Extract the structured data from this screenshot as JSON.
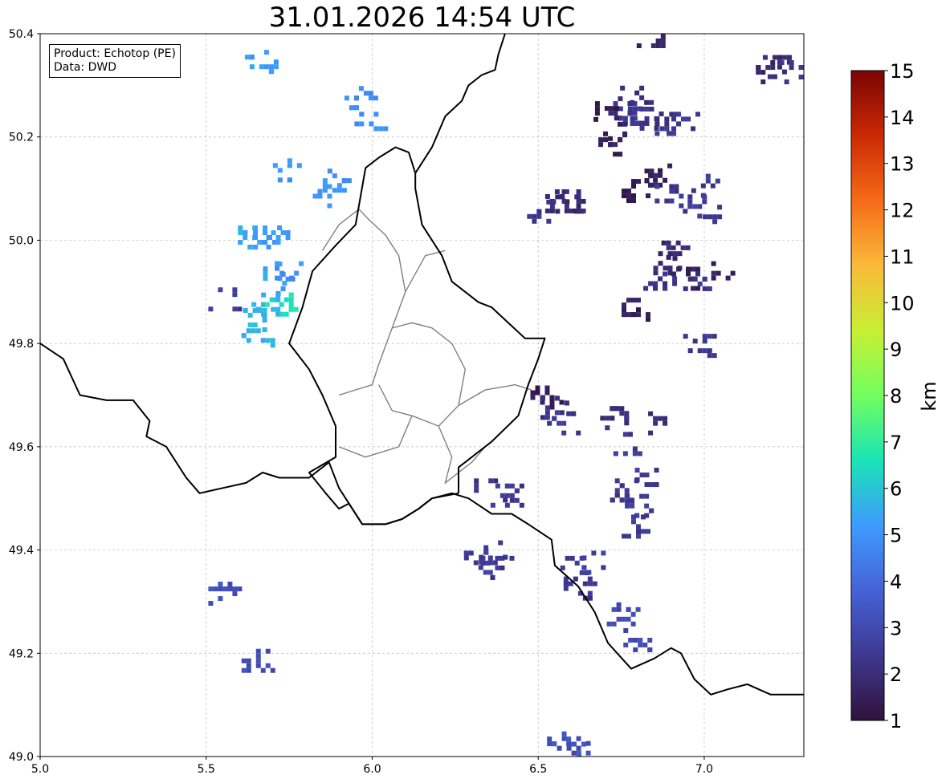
{
  "title": "31.01.2026 14:54 UTC",
  "info": {
    "product": "Product: Echotop (PE)",
    "source": "Data: DWD"
  },
  "map": {
    "lon_range": [
      5.0,
      7.3
    ],
    "lat_range": [
      49.0,
      50.4
    ],
    "x_ticks": [
      "5.0",
      "5.5",
      "6.0",
      "6.5",
      "7.0"
    ],
    "y_ticks": [
      "50.4",
      "50.2",
      "50.0",
      "49.8",
      "49.6",
      "49.4",
      "49.2",
      "49.0"
    ],
    "grid": true
  },
  "colorbar": {
    "label": "km",
    "min": 1,
    "max": 15,
    "ticks": [
      "15",
      "14",
      "13",
      "12",
      "11",
      "10",
      "9",
      "8",
      "7",
      "6",
      "5",
      "4",
      "3",
      "2",
      "1"
    ],
    "colormap": [
      "#30123b",
      "#3e3891",
      "#4662d7",
      "#3e9bfe",
      "#1ae4b6",
      "#72fe5e",
      "#c7ef34",
      "#faba39",
      "#f66b19",
      "#ca2a04",
      "#7a0403"
    ]
  },
  "echoes": [
    {
      "lon": 5.66,
      "lat": 50.35,
      "km": 5.2
    },
    {
      "lon": 5.96,
      "lat": 50.28,
      "km": 4.8
    },
    {
      "lon": 5.99,
      "lat": 50.23,
      "km": 5.0
    },
    {
      "lon": 5.73,
      "lat": 50.14,
      "km": 5.0
    },
    {
      "lon": 5.85,
      "lat": 50.09,
      "km": 5.1
    },
    {
      "lon": 5.88,
      "lat": 50.12,
      "km": 5.0
    },
    {
      "lon": 5.61,
      "lat": 50.01,
      "km": 5.6
    },
    {
      "lon": 5.67,
      "lat": 50.01,
      "km": 5.2
    },
    {
      "lon": 5.71,
      "lat": 50.01,
      "km": 5.2
    },
    {
      "lon": 5.7,
      "lat": 49.94,
      "km": 5.3
    },
    {
      "lon": 5.71,
      "lat": 49.92,
      "km": 5.0
    },
    {
      "lon": 5.68,
      "lat": 49.88,
      "km": 5.6
    },
    {
      "lon": 5.72,
      "lat": 49.88,
      "km": 6.5
    },
    {
      "lon": 5.64,
      "lat": 49.85,
      "km": 5.8
    },
    {
      "lon": 5.65,
      "lat": 49.82,
      "km": 5.6
    },
    {
      "lon": 5.75,
      "lat": 49.95,
      "km": 5.0
    },
    {
      "lon": 5.55,
      "lat": 49.89,
      "km": 2.5
    },
    {
      "lon": 5.55,
      "lat": 49.32,
      "km": 3.2
    },
    {
      "lon": 5.65,
      "lat": 49.19,
      "km": 3.0
    },
    {
      "lon": 6.32,
      "lat": 49.38,
      "km": 2.5
    },
    {
      "lon": 6.37,
      "lat": 49.37,
      "km": 2.4
    },
    {
      "lon": 6.35,
      "lat": 49.4,
      "km": 2.4
    },
    {
      "lon": 6.35,
      "lat": 49.52,
      "km": 2.2
    },
    {
      "lon": 6.4,
      "lat": 49.51,
      "km": 2.4
    },
    {
      "lon": 6.52,
      "lat": 49.7,
      "km": 1.4
    },
    {
      "lon": 6.55,
      "lat": 49.68,
      "km": 2.2
    },
    {
      "lon": 6.57,
      "lat": 49.65,
      "km": 2.4
    },
    {
      "lon": 6.61,
      "lat": 49.37,
      "km": 2.5
    },
    {
      "lon": 6.66,
      "lat": 49.38,
      "km": 2.5
    },
    {
      "lon": 6.62,
      "lat": 49.33,
      "km": 2.4
    },
    {
      "lon": 6.75,
      "lat": 49.28,
      "km": 3.0
    },
    {
      "lon": 6.8,
      "lat": 49.23,
      "km": 3.0
    },
    {
      "lon": 6.6,
      "lat": 49.03,
      "km": 3.2
    },
    {
      "lon": 6.63,
      "lat": 49.01,
      "km": 3.4
    },
    {
      "lon": 6.57,
      "lat": 49.02,
      "km": 3.2
    },
    {
      "lon": 6.76,
      "lat": 49.52,
      "km": 2.4
    },
    {
      "lon": 6.79,
      "lat": 49.49,
      "km": 2.5
    },
    {
      "lon": 6.78,
      "lat": 49.45,
      "km": 2.4
    },
    {
      "lon": 6.82,
      "lat": 49.55,
      "km": 2.4
    },
    {
      "lon": 6.77,
      "lat": 49.61,
      "km": 2.4
    },
    {
      "lon": 6.86,
      "lat": 49.65,
      "km": 2.0
    },
    {
      "lon": 6.73,
      "lat": 49.66,
      "km": 2.0
    },
    {
      "lon": 6.78,
      "lat": 49.87,
      "km": 1.5
    },
    {
      "lon": 6.98,
      "lat": 49.8,
      "km": 2.4
    },
    {
      "lon": 6.55,
      "lat": 50.08,
      "km": 2.0
    },
    {
      "lon": 6.51,
      "lat": 50.06,
      "km": 2.2
    },
    {
      "lon": 6.58,
      "lat": 50.07,
      "km": 1.8
    },
    {
      "lon": 6.77,
      "lat": 50.25,
      "km": 2.4
    },
    {
      "lon": 6.82,
      "lat": 50.24,
      "km": 2.3
    },
    {
      "lon": 6.88,
      "lat": 50.23,
      "km": 2.2
    },
    {
      "lon": 6.93,
      "lat": 50.23,
      "km": 2.4
    },
    {
      "lon": 6.74,
      "lat": 50.26,
      "km": 2.2
    },
    {
      "lon": 6.79,
      "lat": 50.29,
      "km": 2.0
    },
    {
      "lon": 6.82,
      "lat": 50.12,
      "km": 1.5
    },
    {
      "lon": 6.78,
      "lat": 50.1,
      "km": 1.4
    },
    {
      "lon": 6.86,
      "lat": 50.13,
      "km": 1.6
    },
    {
      "lon": 6.88,
      "lat": 50.09,
      "km": 2.3
    },
    {
      "lon": 6.95,
      "lat": 50.07,
      "km": 2.4
    },
    {
      "lon": 6.99,
      "lat": 50.11,
      "km": 2.4
    },
    {
      "lon": 7.01,
      "lat": 50.05,
      "km": 2.2
    },
    {
      "lon": 6.89,
      "lat": 49.96,
      "km": 1.8
    },
    {
      "lon": 6.86,
      "lat": 49.93,
      "km": 2.2
    },
    {
      "lon": 6.93,
      "lat": 49.93,
      "km": 1.6
    },
    {
      "lon": 6.98,
      "lat": 49.92,
      "km": 2.3
    },
    {
      "lon": 6.9,
      "lat": 49.99,
      "km": 1.9
    },
    {
      "lon": 7.05,
      "lat": 49.95,
      "km": 1.6
    },
    {
      "lon": 6.84,
      "lat": 50.4,
      "km": 1.7
    },
    {
      "lon": 7.22,
      "lat": 50.34,
      "km": 1.9
    },
    {
      "lon": 7.27,
      "lat": 50.33,
      "km": 2.2
    },
    {
      "lon": 7.17,
      "lat": 50.33,
      "km": 1.8
    },
    {
      "lon": 6.7,
      "lat": 50.26,
      "km": 1.5
    },
    {
      "lon": 6.71,
      "lat": 50.22,
      "km": 1.6
    },
    {
      "lon": 6.71,
      "lat": 50.19,
      "km": 1.6
    },
    {
      "lon": 6.6,
      "lat": 50.08,
      "km": 1.8
    }
  ],
  "borders": {
    "country": [
      [
        [
          5.0,
          49.8
        ],
        [
          5.07,
          49.77
        ],
        [
          5.12,
          49.7
        ],
        [
          5.2,
          49.69
        ],
        [
          5.28,
          49.69
        ],
        [
          5.33,
          49.65
        ],
        [
          5.32,
          49.62
        ],
        [
          5.38,
          49.6
        ],
        [
          5.44,
          49.54
        ],
        [
          5.48,
          49.51
        ],
        [
          5.55,
          49.52
        ],
        [
          5.62,
          49.53
        ],
        [
          5.67,
          49.55
        ],
        [
          5.72,
          49.54
        ],
        [
          5.81,
          49.54
        ],
        [
          5.87,
          49.57
        ],
        [
          5.9,
          49.52
        ],
        [
          5.93,
          49.49
        ]
      ],
      [
        [
          5.93,
          49.49
        ],
        [
          5.97,
          49.45
        ],
        [
          6.04,
          49.45
        ],
        [
          6.09,
          49.46
        ],
        [
          6.14,
          49.48
        ],
        [
          6.18,
          49.5
        ],
        [
          6.24,
          49.51
        ],
        [
          6.29,
          49.5
        ],
        [
          6.36,
          49.47
        ],
        [
          6.42,
          49.47
        ],
        [
          6.47,
          49.45
        ],
        [
          6.54,
          49.42
        ],
        [
          6.55,
          49.37
        ],
        [
          6.62,
          49.33
        ],
        [
          6.67,
          49.28
        ],
        [
          6.71,
          49.22
        ],
        [
          6.78,
          49.17
        ],
        [
          6.85,
          49.19
        ],
        [
          6.9,
          49.21
        ],
        [
          6.93,
          49.2
        ],
        [
          6.97,
          49.15
        ],
        [
          7.02,
          49.12
        ],
        [
          7.07,
          49.13
        ],
        [
          7.13,
          49.14
        ],
        [
          7.2,
          49.12
        ],
        [
          7.3,
          49.12
        ]
      ],
      [
        [
          6.26,
          49.51
        ],
        [
          6.26,
          49.56
        ],
        [
          6.36,
          49.61
        ],
        [
          6.44,
          49.66
        ],
        [
          6.47,
          49.72
        ],
        [
          6.5,
          49.77
        ],
        [
          6.52,
          49.81
        ],
        [
          6.46,
          49.81
        ],
        [
          6.36,
          49.87
        ],
        [
          6.32,
          49.88
        ],
        [
          6.24,
          49.92
        ],
        [
          6.21,
          49.97
        ],
        [
          6.15,
          50.03
        ],
        [
          6.13,
          50.1
        ],
        [
          6.13,
          50.13
        ],
        [
          6.11,
          50.17
        ],
        [
          6.07,
          50.18
        ],
        [
          6.02,
          50.16
        ],
        [
          5.98,
          50.14
        ],
        [
          5.95,
          50.03
        ],
        [
          5.89,
          49.99
        ],
        [
          5.82,
          49.94
        ],
        [
          5.79,
          49.87
        ],
        [
          5.75,
          49.8
        ],
        [
          5.81,
          49.75
        ],
        [
          5.85,
          49.7
        ],
        [
          5.89,
          49.64
        ],
        [
          5.89,
          49.58
        ],
        [
          5.81,
          49.55
        ],
        [
          5.86,
          49.51
        ],
        [
          5.9,
          49.48
        ],
        [
          5.93,
          49.49
        ],
        [
          5.97,
          49.45
        ],
        [
          6.04,
          49.45
        ],
        [
          6.09,
          49.46
        ],
        [
          6.14,
          49.48
        ],
        [
          6.18,
          49.5
        ],
        [
          6.26,
          49.51
        ]
      ],
      [
        [
          6.13,
          50.13
        ],
        [
          6.18,
          50.18
        ],
        [
          6.22,
          50.24
        ],
        [
          6.27,
          50.27
        ],
        [
          6.29,
          50.3
        ],
        [
          6.33,
          50.32
        ],
        [
          6.37,
          50.33
        ],
        [
          6.38,
          50.36
        ],
        [
          6.4,
          50.4
        ]
      ]
    ],
    "district": [
      [
        [
          5.85,
          49.98
        ],
        [
          5.9,
          50.03
        ],
        [
          5.96,
          50.06
        ],
        [
          5.99,
          50.04
        ],
        [
          6.04,
          50.01
        ],
        [
          6.08,
          49.97
        ],
        [
          6.1,
          49.9
        ],
        [
          6.06,
          49.83
        ],
        [
          6.02,
          49.76
        ],
        [
          6.0,
          49.72
        ],
        [
          5.9,
          49.7
        ]
      ],
      [
        [
          6.06,
          49.83
        ],
        [
          6.12,
          49.84
        ],
        [
          6.18,
          49.83
        ],
        [
          6.24,
          49.8
        ],
        [
          6.28,
          49.75
        ],
        [
          6.26,
          49.68
        ],
        [
          6.2,
          49.64
        ],
        [
          6.12,
          49.66
        ],
        [
          6.06,
          49.67
        ],
        [
          6.02,
          49.72
        ]
      ],
      [
        [
          6.26,
          49.68
        ],
        [
          6.34,
          49.71
        ],
        [
          6.43,
          49.72
        ],
        [
          6.48,
          49.71
        ]
      ],
      [
        [
          6.1,
          49.9
        ],
        [
          6.16,
          49.97
        ],
        [
          6.22,
          49.98
        ]
      ],
      [
        [
          6.12,
          49.66
        ],
        [
          6.08,
          49.6
        ],
        [
          5.98,
          49.58
        ],
        [
          5.9,
          49.6
        ]
      ],
      [
        [
          6.2,
          49.64
        ],
        [
          6.24,
          49.58
        ],
        [
          6.22,
          49.53
        ],
        [
          6.3,
          49.57
        ],
        [
          6.34,
          49.6
        ]
      ]
    ]
  }
}
